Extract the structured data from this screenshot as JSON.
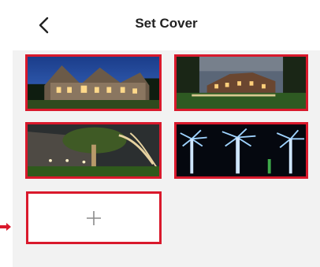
{
  "header": {
    "title": "Set Cover",
    "back_icon": "chevron-left-icon"
  },
  "cover_grid": {
    "images": [
      {
        "name": "cover-image-house-front-dusk"
      },
      {
        "name": "cover-image-estate-lawn-evening"
      },
      {
        "name": "cover-image-backyard-tree-uplights"
      },
      {
        "name": "cover-image-palm-trees-night"
      }
    ],
    "add_button_icon": "plus-icon"
  },
  "colors": {
    "highlight": "#d9192c",
    "panel": "#f2f2f2"
  },
  "pointer": {
    "icon": "arrow-right-icon"
  }
}
